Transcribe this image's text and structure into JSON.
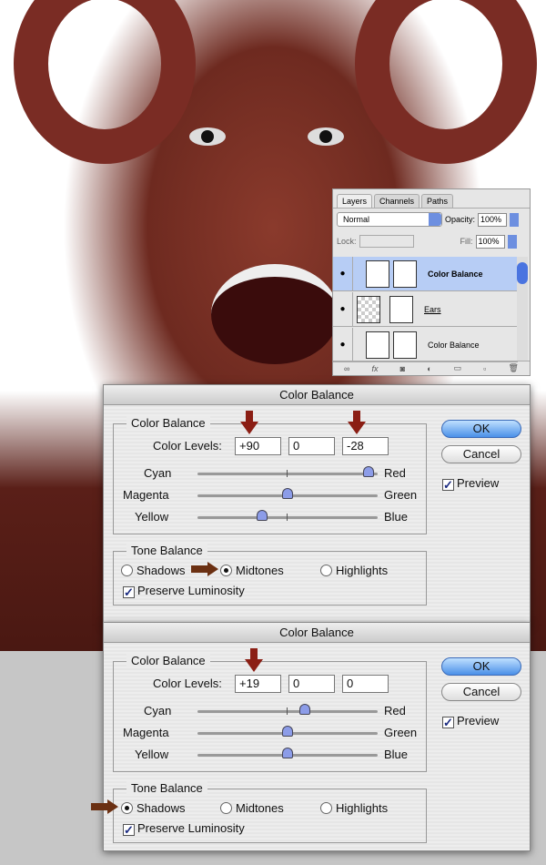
{
  "layers_panel": {
    "tabs": [
      "Layers",
      "Channels",
      "Paths"
    ],
    "blend_mode": "Normal",
    "opacity_label": "Opacity:",
    "opacity": "100%",
    "lock_label": "Lock:",
    "fill_label": "Fill:",
    "fill": "100%",
    "layers": [
      {
        "name": "Color Balance",
        "selected": true
      },
      {
        "name": "Ears",
        "selected": false
      },
      {
        "name": "Color Balance",
        "selected": false
      }
    ],
    "bottom_icons": [
      "link-icon",
      "fx-icon",
      "mask-icon",
      "adjustment-icon",
      "folder-icon",
      "new-layer-icon",
      "trash-icon"
    ]
  },
  "dialogs": [
    {
      "title": "Color Balance",
      "group_label": "Color Balance",
      "levels_label": "Color Levels:",
      "levels": [
        "+90",
        "0",
        "-28"
      ],
      "sliders": [
        {
          "left": "Cyan",
          "right": "Red",
          "value": 90
        },
        {
          "left": "Magenta",
          "right": "Green",
          "value": 0
        },
        {
          "left": "Yellow",
          "right": "Blue",
          "value": -28
        }
      ],
      "tone_label": "Tone Balance",
      "tones": [
        "Shadows",
        "Midtones",
        "Highlights"
      ],
      "selected_tone": "Midtones",
      "preserve": "Preserve Luminosity",
      "ok": "OK",
      "cancel": "Cancel",
      "preview": "Preview"
    },
    {
      "title": "Color Balance",
      "group_label": "Color Balance",
      "levels_label": "Color Levels:",
      "levels": [
        "+19",
        "0",
        "0"
      ],
      "sliders": [
        {
          "left": "Cyan",
          "right": "Red",
          "value": 19
        },
        {
          "left": "Magenta",
          "right": "Green",
          "value": 0
        },
        {
          "left": "Yellow",
          "right": "Blue",
          "value": 0
        }
      ],
      "tone_label": "Tone Balance",
      "tones": [
        "Shadows",
        "Midtones",
        "Highlights"
      ],
      "selected_tone": "Shadows",
      "preserve": "Preserve Luminosity",
      "ok": "OK",
      "cancel": "Cancel",
      "preview": "Preview"
    }
  ],
  "colors": {
    "arrow": "#8b1e14",
    "accent": "#4a90e8"
  }
}
